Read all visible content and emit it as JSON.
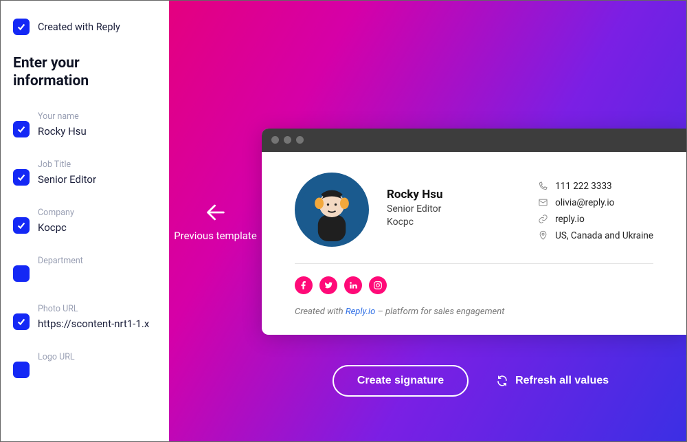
{
  "sidebar": {
    "created_with_label": "Created with Reply",
    "heading": "Enter your information",
    "fields": {
      "name": {
        "label": "Your name",
        "value": "Rocky Hsu",
        "checked": true
      },
      "job_title": {
        "label": "Job Title",
        "value": "Senior Editor",
        "checked": true
      },
      "company": {
        "label": "Company",
        "value": "Kocpc",
        "checked": true
      },
      "department": {
        "label": "Department",
        "value": "",
        "checked": false
      },
      "photo_url": {
        "label": "Photo URL",
        "value": "https://scontent-nrt1-1.x",
        "checked": true
      },
      "logo_url": {
        "label": "Logo URL",
        "value": "",
        "checked": false
      }
    }
  },
  "nav": {
    "previous_label": "Previous template"
  },
  "preview": {
    "name": "Rocky Hsu",
    "job_title": "Senior Editor",
    "company": "Kocpc",
    "contact": {
      "phone": "111 222 3333",
      "email": "olivia@reply.io",
      "website": "reply.io",
      "address": "US, Canada and Ukraine"
    },
    "credit_prefix": "Created with ",
    "credit_link_text": "Reply.io",
    "credit_suffix": " – platform for sales engagement"
  },
  "buttons": {
    "create_signature": "Create signature",
    "refresh_values": "Refresh all values"
  }
}
